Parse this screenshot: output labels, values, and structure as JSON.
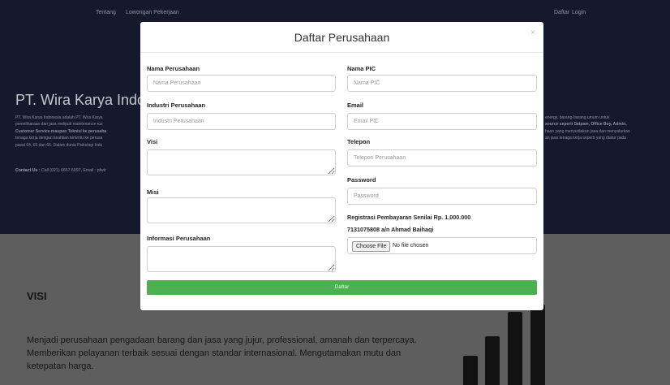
{
  "nav": {
    "left_items": [
      "Tentang",
      "Lowongan Pekerjaan"
    ],
    "right_items": [
      "Daftar",
      "Login"
    ]
  },
  "hero": {
    "title": "PT. Wira Karya Indonesia",
    "text_lines_left": [
      "PT. Wira Karya Indonesia adalah PT. Wira Karya",
      "pemeliharaan dan jasa meliputi maintenance rus",
      "Customer Service maupun Teknisi ke perusaha",
      "tenaga kerja dengan keahlian tertentu ke perusa",
      "pasal 64, 65 dan 66. Dalam dunia Psikologi Indu"
    ],
    "text_lines_right": [
      "energy, barang-barang umum untuk",
      "source seperti Satpam, Office Boy, Admin,",
      "haan yang menyediakan jasa dan menyalurkan",
      "an jasa tenaga kerja seperti yang diatur pada",
      ""
    ],
    "contact_label": "Contact Us :",
    "contact_value": "Call (021) 6667 6097, Email : pfwir"
  },
  "visi": {
    "title": "VISI",
    "text": "Menjadi perusahaan pengadaan barang dan jasa yang jujur, professional, amanah dan terpercaya. Memberikan pelayanan terbaik sesuai dengan standar internasional. Mengutamakan mutu dan ketepatan harga."
  },
  "modal": {
    "title": "Daftar Perusahaan",
    "close": "×",
    "fields": {
      "nama_perusahaan": {
        "label": "Nama Perusahaan",
        "placeholder": "Nama Perusahaan",
        "value": ""
      },
      "industri": {
        "label": "Industri Perusahaan",
        "placeholder": "Industri Perusahaan",
        "value": ""
      },
      "visi": {
        "label": "Visi",
        "value": ""
      },
      "misi": {
        "label": "Misi",
        "value": ""
      },
      "informasi": {
        "label": "Informasi Perusahaan",
        "value": ""
      },
      "nama_pic": {
        "label": "Nama PIC",
        "placeholder": "Nama PIC",
        "value": ""
      },
      "email": {
        "label": "Email",
        "placeholder": "Email PIC",
        "value": ""
      },
      "telepon": {
        "label": "Telepon",
        "placeholder": "Telepon Perusahaan",
        "value": ""
      },
      "password": {
        "label": "Password",
        "placeholder": "Password",
        "value": ""
      }
    },
    "registration": {
      "line1": "Registrasi Pembayaran Senilai Rp. 1.000.000",
      "line2": "7131075808 a/n Ahmad Baihaqi",
      "file_button": "Choose File",
      "file_status": "No file chosen"
    },
    "submit_label": "Daftar"
  }
}
